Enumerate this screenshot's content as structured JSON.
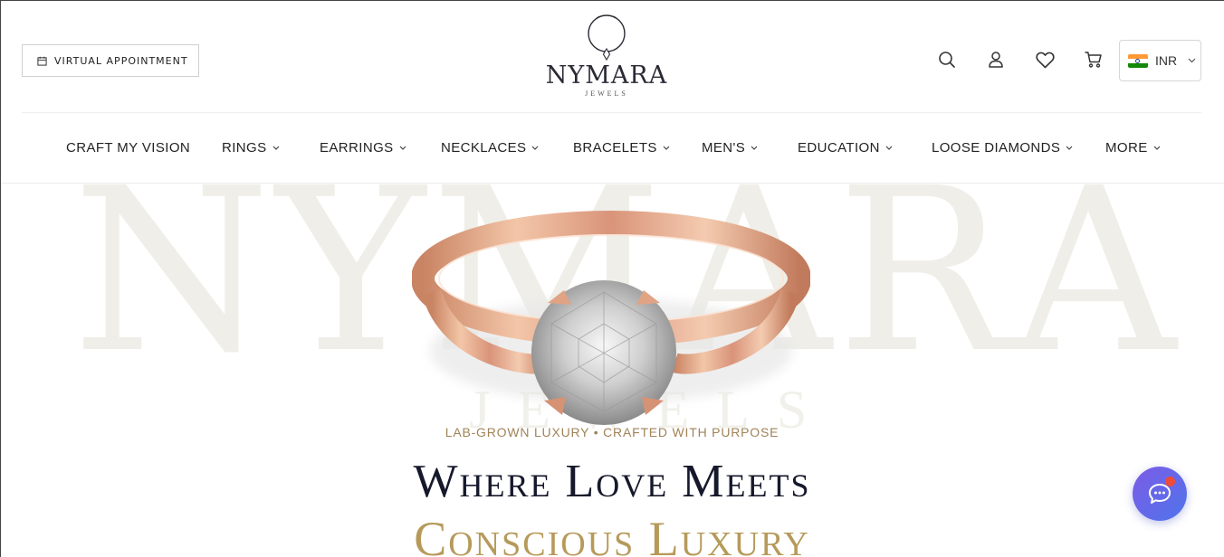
{
  "header": {
    "appointment_label": "VIRTUAL APPOINTMENT",
    "logo_brand": "NYMARA",
    "logo_sub": "JEWELS",
    "icons": [
      "search-icon",
      "user-icon",
      "heart-icon",
      "cart-icon"
    ],
    "currency": {
      "code": "INR",
      "flag": "india-flag-icon"
    }
  },
  "nav": {
    "items": [
      {
        "label": "CRAFT MY VISION",
        "has_dropdown": false
      },
      {
        "label": "RINGS",
        "has_dropdown": true
      },
      {
        "label": "EARRINGS",
        "has_dropdown": true
      },
      {
        "label": "NECKLACES",
        "has_dropdown": true
      },
      {
        "label": "BRACELETS",
        "has_dropdown": true
      },
      {
        "label": "MEN'S",
        "has_dropdown": true
      },
      {
        "label": "EDUCATION",
        "has_dropdown": true
      },
      {
        "label": "LOOSE DIAMONDS",
        "has_dropdown": true
      },
      {
        "label": "MORE",
        "has_dropdown": true
      }
    ]
  },
  "hero": {
    "watermark": "NYMARA",
    "watermark_sub": "JEWELS",
    "tagline": "LAB-GROWN LUXURY • CRAFTED WITH PURPOSE",
    "headline_line1": "Where Love Meets",
    "headline_line2": "Conscious Luxury"
  },
  "colors": {
    "gold_accent": "#a08358",
    "headline_dark": "#16182b",
    "headline_gold": "#b69a5a",
    "chat_gradient_start": "#7c5ce6",
    "chat_gradient_end": "#4f74ec",
    "notification_dot": "#ee4b3a"
  }
}
